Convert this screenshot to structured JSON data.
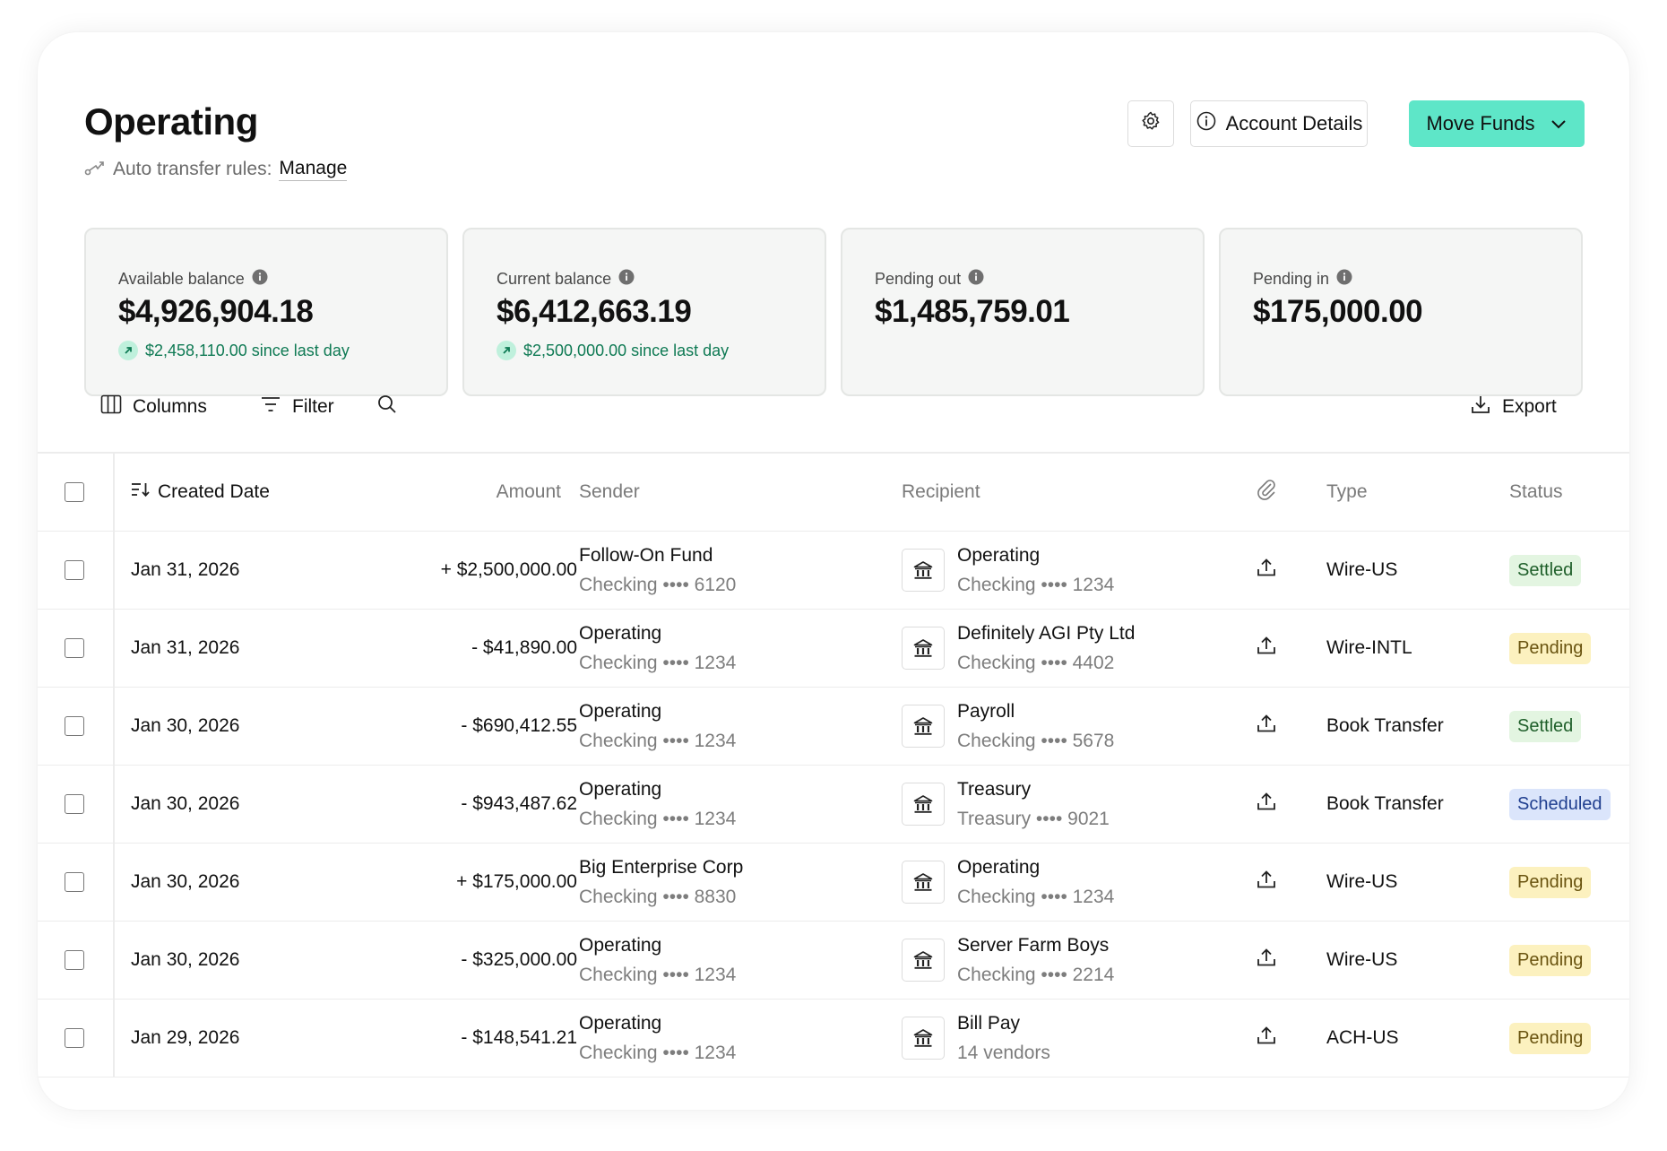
{
  "header": {
    "title": "Operating",
    "auto_transfer_label": "Auto transfer rules:",
    "manage_link": "Manage",
    "account_details_label": "Account Details",
    "move_funds_label": "Move Funds"
  },
  "stats": [
    {
      "label": "Available balance",
      "value": "$4,926,904.18",
      "delta": "$2,458,110.00 since last day"
    },
    {
      "label": "Current balance",
      "value": "$6,412,663.19",
      "delta": "$2,500,000.00 since last day"
    },
    {
      "label": "Pending out",
      "value": "$1,485,759.01"
    },
    {
      "label": "Pending in",
      "value": "$175,000.00"
    }
  ],
  "toolbar": {
    "columns": "Columns",
    "filter": "Filter",
    "export": "Export"
  },
  "table": {
    "headers": {
      "created_date": "Created Date",
      "amount": "Amount",
      "sender": "Sender",
      "recipient": "Recipient",
      "type": "Type",
      "status": "Status"
    },
    "rows": [
      {
        "date": "Jan 31, 2026",
        "amount": "+ $2,500,000.00",
        "sender_name": "Follow-On Fund",
        "sender_account": "Checking •••• 6120",
        "recipient_name": "Operating",
        "recipient_account": "Checking •••• 1234",
        "type": "Wire-US",
        "status": "Settled"
      },
      {
        "date": "Jan 31, 2026",
        "amount": "- $41,890.00",
        "sender_name": "Operating",
        "sender_account": "Checking •••• 1234",
        "recipient_name": "Definitely AGI Pty Ltd",
        "recipient_account": "Checking •••• 4402",
        "type": "Wire-INTL",
        "status": "Pending"
      },
      {
        "date": "Jan 30, 2026",
        "amount": "- $690,412.55",
        "sender_name": "Operating",
        "sender_account": "Checking •••• 1234",
        "recipient_name": "Payroll",
        "recipient_account": "Checking •••• 5678",
        "type": "Book Transfer",
        "status": "Settled"
      },
      {
        "date": "Jan 30, 2026",
        "amount": "- $943,487.62",
        "sender_name": "Operating",
        "sender_account": "Checking •••• 1234",
        "recipient_name": "Treasury",
        "recipient_account": "Treasury •••• 9021",
        "type": "Book Transfer",
        "status": "Scheduled"
      },
      {
        "date": "Jan 30, 2026",
        "amount": "+ $175,000.00",
        "sender_name": "Big Enterprise Corp",
        "sender_account": "Checking •••• 8830",
        "recipient_name": "Operating",
        "recipient_account": "Checking •••• 1234",
        "type": "Wire-US",
        "status": "Pending"
      },
      {
        "date": "Jan 30, 2026",
        "amount": "- $325,000.00",
        "sender_name": "Operating",
        "sender_account": "Checking •••• 1234",
        "recipient_name": "Server Farm Boys",
        "recipient_account": "Checking •••• 2214",
        "type": "Wire-US",
        "status": "Pending"
      },
      {
        "date": "Jan 29, 2026",
        "amount": "- $148,541.21",
        "sender_name": "Operating",
        "sender_account": "Checking •••• 1234",
        "recipient_name": "Bill Pay",
        "recipient_account": "14 vendors",
        "type": "ACH-US",
        "status": "Pending"
      }
    ]
  },
  "colors": {
    "accent": "#5ee6c8",
    "positive": "#0f7a54",
    "settled_bg": "#e3f5e1",
    "pending_bg": "#fcf1bf",
    "scheduled_bg": "#dbe5fb"
  }
}
